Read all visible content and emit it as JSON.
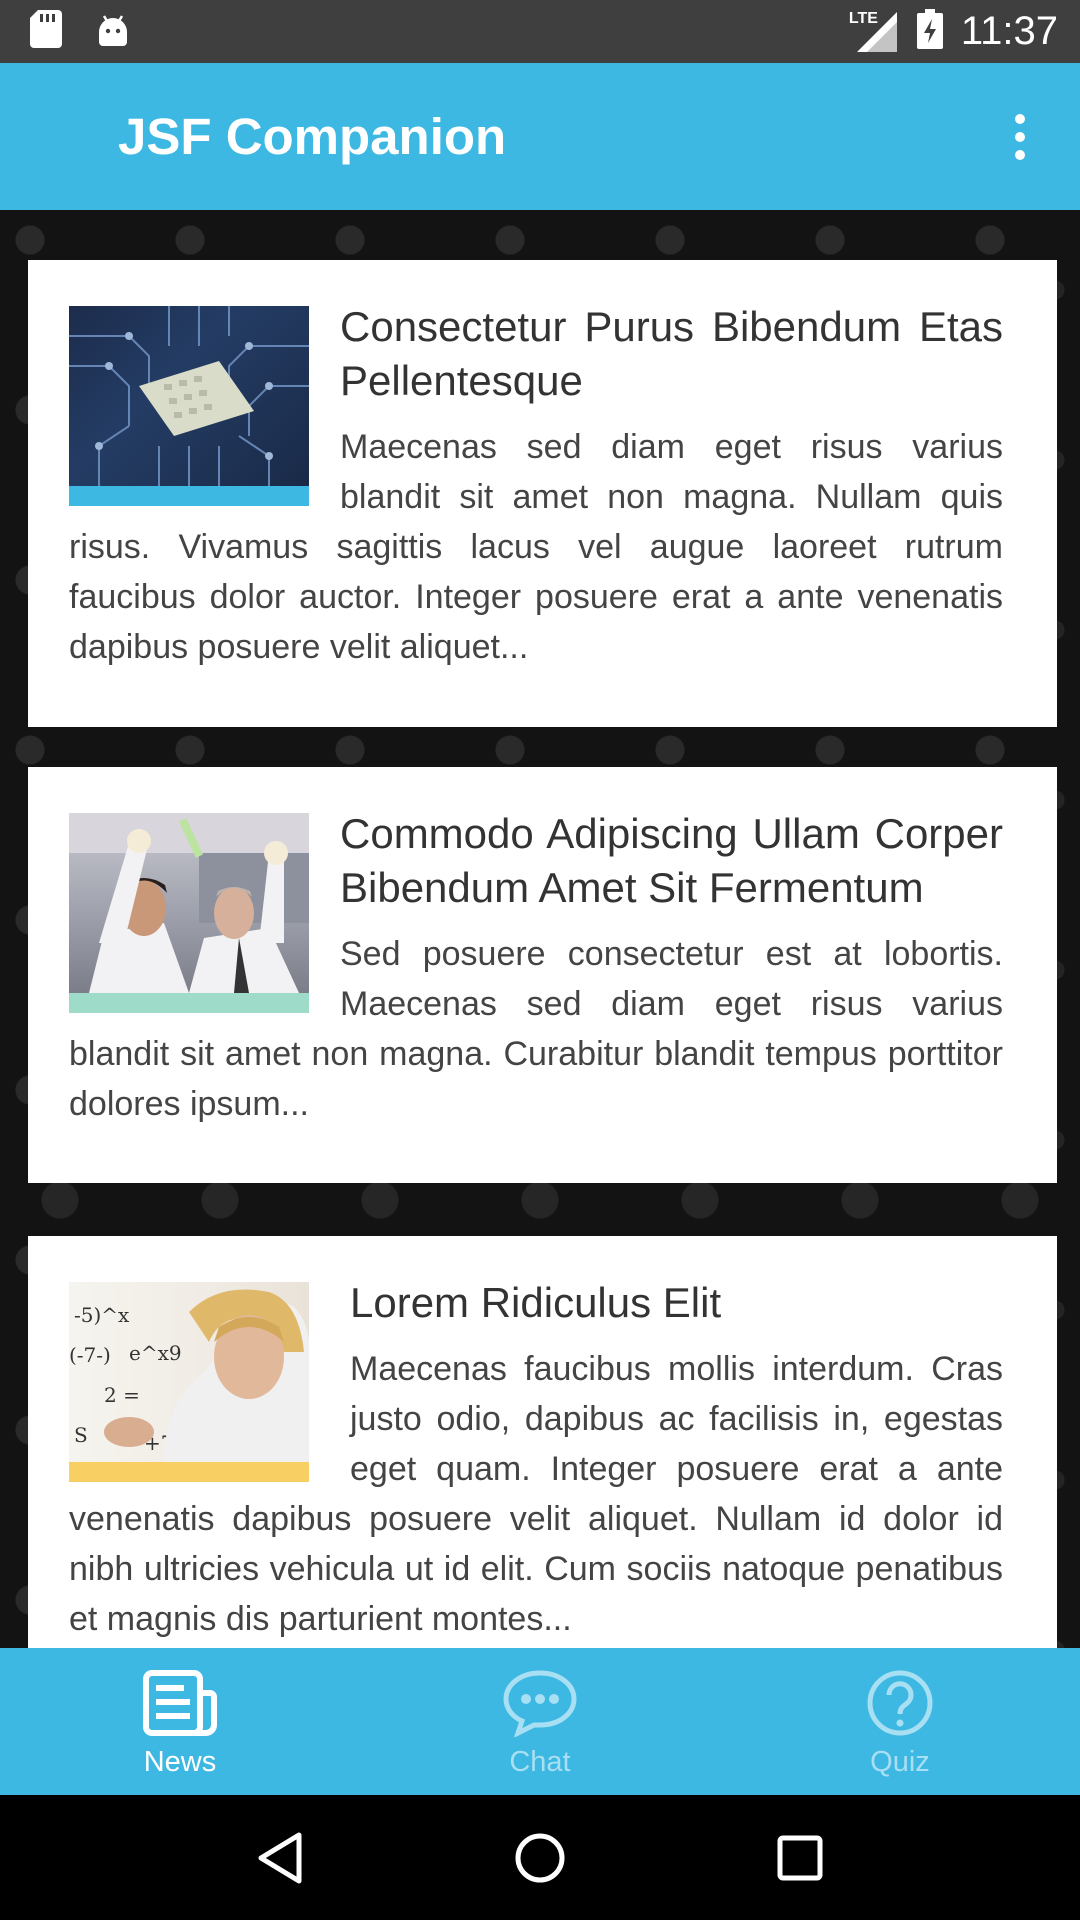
{
  "status_bar": {
    "time": "11:37",
    "network": "LTE",
    "icons": [
      "sd-card-icon",
      "android-icon",
      "lte-signal-icon",
      "battery-icon"
    ]
  },
  "app_bar": {
    "title": "JSF Companion",
    "menu_icon": "more-vert-icon"
  },
  "news": [
    {
      "title": "Consectetur Purus Bibendum Etas Pellentesque",
      "body": "Maecenas sed diam eget risus varius blandit sit amet non magna. Nullam quis risus. Vivamus sagittis lacus vel augue laoreet rutrum faucibus dolor auctor. Integer posuere erat a ante venenatis dapibus posuere velit aliquet...",
      "thumb_icon": "circuit-board-image",
      "accent": "#3cb8e3"
    },
    {
      "title": "Commodo Adipiscing Ullam Corper Bibendum Amet Sit Fermentum",
      "body": "Sed posuere consectetur est at lobortis. Maecenas sed diam eget risus varius blandit sit amet non magna. Curabitur blandit tempus porttitor dolores ipsum...",
      "thumb_icon": "scientists-image",
      "accent": "#9edbc8"
    },
    {
      "title": "Lorem Ridiculus Elit",
      "body": "Maecenas faucibus mollis interdum. Cras justo odio, dapibus ac facilisis in, egestas eget quam. Integer posuere erat a ante venenatis dapibus posuere velit aliquet. Nullam id dolor id nibh ultricies vehicula ut id elit. Cum sociis natoque penatibus et magnis dis parturient montes...",
      "thumb_icon": "math-woman-image",
      "accent": "#f8cf62"
    }
  ],
  "bottom_nav": {
    "items": [
      {
        "label": "News",
        "icon": "news-icon",
        "active": true
      },
      {
        "label": "Chat",
        "icon": "chat-icon",
        "active": false
      },
      {
        "label": "Quiz",
        "icon": "help-circle-icon",
        "active": false
      }
    ]
  },
  "system_nav": [
    "back-icon",
    "home-icon",
    "recents-icon"
  ],
  "colors": {
    "primary": "#3cb8e3",
    "status_bar": "#3f3f3f",
    "inactive_nav": "#a9dff2"
  }
}
